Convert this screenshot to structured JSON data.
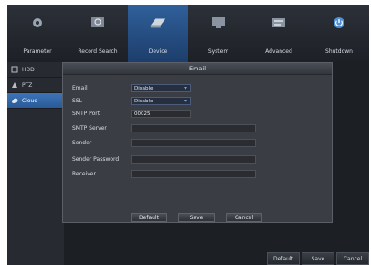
{
  "nav": {
    "items": [
      {
        "label": "Parameter",
        "icon": "gear-icon"
      },
      {
        "label": "Record Search",
        "icon": "search-icon"
      },
      {
        "label": "Device",
        "icon": "hdd-icon"
      },
      {
        "label": "System",
        "icon": "monitor-icon"
      },
      {
        "label": "Advanced",
        "icon": "advanced-icon"
      },
      {
        "label": "Shutdown",
        "icon": "power-icon"
      }
    ],
    "active_index": 2
  },
  "sidebar": {
    "items": [
      {
        "label": "HDD",
        "icon": "hdd-small-icon"
      },
      {
        "label": "PTZ",
        "icon": "ptz-icon"
      },
      {
        "label": "Cloud",
        "icon": "cloud-icon"
      }
    ],
    "active_index": 2
  },
  "dialog": {
    "title": "Email",
    "fields": {
      "email": {
        "label": "Email",
        "value": "Disable"
      },
      "ssl": {
        "label": "SSL",
        "value": "Disable"
      },
      "smtp_port": {
        "label": "SMTP Port",
        "value": "00025"
      },
      "smtp_server": {
        "label": "SMTP Server",
        "value": ""
      },
      "sender": {
        "label": "Sender",
        "value": ""
      },
      "sender_password": {
        "label": "Sender Password",
        "value": ""
      },
      "receiver": {
        "label": "Receiver",
        "value": ""
      }
    },
    "buttons": {
      "default": "Default",
      "save": "Save",
      "cancel": "Cancel"
    }
  },
  "page_buttons": {
    "default": "Default",
    "save": "Save",
    "cancel": "Cancel"
  },
  "colors": {
    "accent": "#2f5f9a",
    "background": "#1c1f24"
  }
}
